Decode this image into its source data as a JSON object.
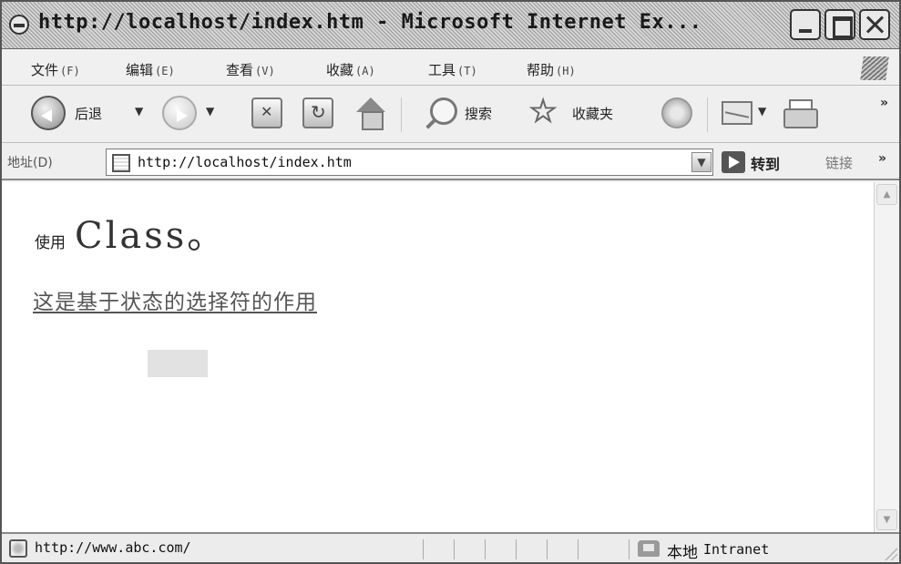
{
  "window": {
    "title": "http://localhost/index.htm - Microsoft Internet Ex..."
  },
  "menu": {
    "items": [
      {
        "label": "文件",
        "accel": "(F)"
      },
      {
        "label": "编辑",
        "accel": "(E)"
      },
      {
        "label": "查看",
        "accel": "(V)"
      },
      {
        "label": "收藏",
        "accel": "(A)"
      },
      {
        "label": "工具",
        "accel": "(T)"
      },
      {
        "label": "帮助",
        "accel": "(H)"
      }
    ]
  },
  "toolbar": {
    "back_label": "后退",
    "search_label": "搜索",
    "favorites_label": "收藏夹",
    "more": "»"
  },
  "address": {
    "label": "地址(D)",
    "url": "http://localhost/index.htm",
    "go_label": "转到",
    "links_label": "链接",
    "more": "»"
  },
  "content": {
    "heading_prefix": "使用",
    "heading_main": "Class。",
    "link_text": "这是基于状态的选择符的作用"
  },
  "status": {
    "url": "http://www.abc.com/",
    "zone_cn": "本地",
    "zone_en": "Intranet"
  },
  "icons": {
    "app": "ie-page-icon",
    "back": "back-arrow-icon",
    "forward": "forward-arrow-icon",
    "stop": "stop-icon",
    "refresh": "refresh-icon",
    "home": "home-icon",
    "search": "search-icon",
    "favorites": "favorites-star-icon",
    "media": "media-icon",
    "mail": "mail-icon",
    "print": "print-icon",
    "go": "go-arrow-icon"
  }
}
